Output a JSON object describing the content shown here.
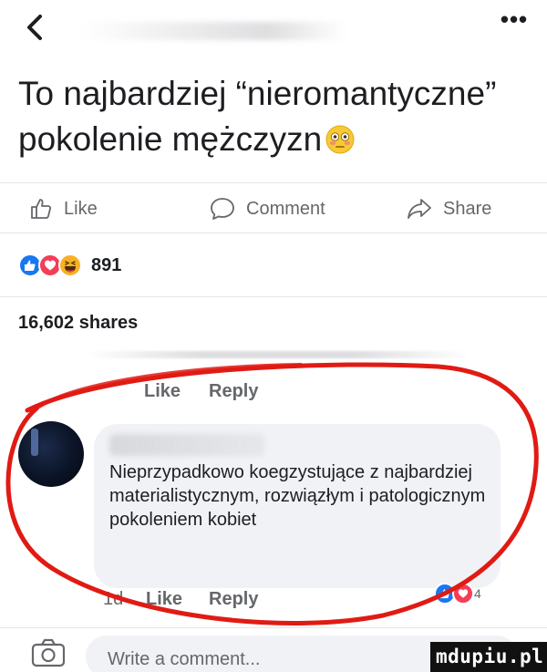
{
  "post": {
    "text": "To najbardziej “nieromantyczne” pokolenie mężczyzn"
  },
  "actions": {
    "like": "Like",
    "comment": "Comment",
    "share": "Share"
  },
  "reactions": {
    "count": "891"
  },
  "shares": "16,602 shares",
  "previous_comment_meta": {
    "like": "Like",
    "reply": "Reply"
  },
  "comment": {
    "text": "Nieprzypadkowo koegzystujące z najbardziej materialistycznym, rozwiązłym i patologicznym pokoleniem kobiet",
    "time": "1d",
    "like": "Like",
    "reply": "Reply",
    "reaction_count": "4"
  },
  "composer": {
    "placeholder": "Write a comment..."
  },
  "watermark": "mdupiu.pl",
  "colors": {
    "like_blue": "#1877f2",
    "love_red": "#f33e58",
    "haha_yellow": "#f7b125",
    "annotation_red": "#e01b14"
  }
}
